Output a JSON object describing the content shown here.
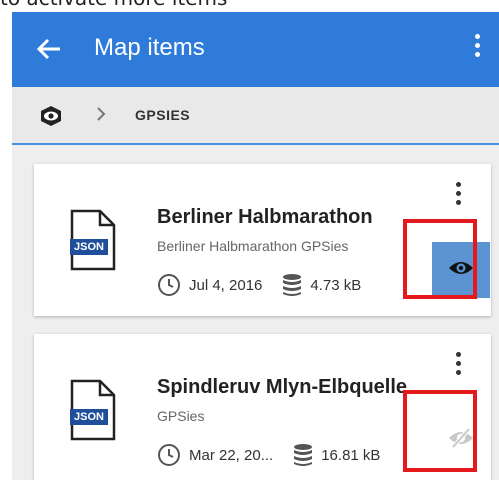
{
  "caption": "to activate more items",
  "appbar": {
    "title": "Map items",
    "back_icon": "arrow-back-icon",
    "menu_icon": "more-vert-icon",
    "color": "#2f7bd9"
  },
  "breadcrumb": {
    "root_icon": "map-items-root-icon",
    "separator_icon": "chevron-right-icon",
    "current": "GPSIES"
  },
  "items": [
    {
      "file_type": "JSON",
      "title": "Berliner Halbmarathon",
      "subtitle": "Berliner Halbmarathon GPSies",
      "date": "Jul 4, 2016",
      "size": "4.73 kB",
      "visible": true,
      "visibility_icon": "eye-icon"
    },
    {
      "file_type": "JSON",
      "title": "Spindleruv Mlyn-Elbquelle",
      "subtitle": "GPSies",
      "date": "Mar 22, 20...",
      "size": "16.81 kB",
      "visible": false,
      "visibility_icon": "eye-off-icon"
    }
  ],
  "highlight_color": "#e4191c"
}
